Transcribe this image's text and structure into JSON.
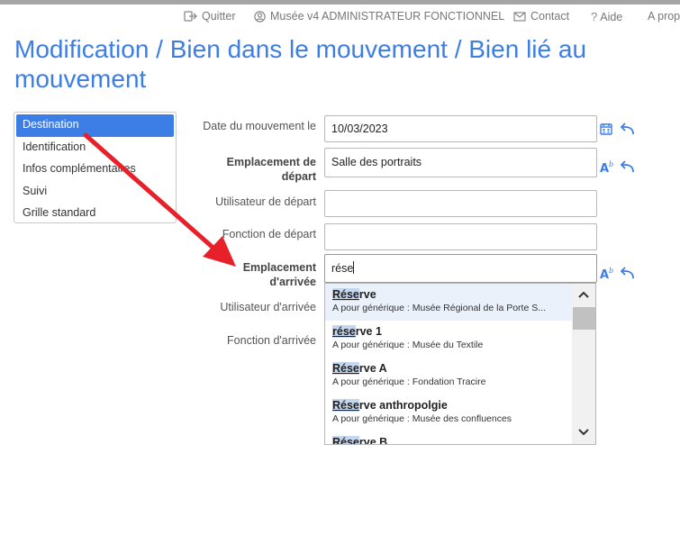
{
  "topnav": {
    "quit": "Quitter",
    "user": "Musée v4 ADMINISTRATEUR FONCTIONNEL",
    "contact": "Contact",
    "help": "Aide",
    "about": "A propos"
  },
  "page": {
    "title": "Modification / Bien dans le mouvement / Bien lié au mouvement"
  },
  "sidebar": {
    "items": [
      {
        "label": "Destination",
        "active": true
      },
      {
        "label": "Identification"
      },
      {
        "label": "Infos complémentaires"
      },
      {
        "label": "Suivi"
      },
      {
        "label": "Grille standard"
      }
    ]
  },
  "form": {
    "date": {
      "label": "Date du mouvement le",
      "value": "10/03/2023"
    },
    "departure_location": {
      "label_line1": "Emplacement de",
      "label_line2": "départ",
      "value": "Salle des portraits"
    },
    "departure_user": {
      "label": "Utilisateur de départ",
      "value": ""
    },
    "departure_function": {
      "label": "Fonction de départ",
      "value": ""
    },
    "arrival_location": {
      "label_line1": "Emplacement",
      "label_line2": "d'arrivée",
      "value": "rése"
    },
    "arrival_user": {
      "label": "Utilisateur d'arrivée"
    },
    "arrival_function": {
      "label": "Fonction d'arrivée"
    }
  },
  "autocomplete": {
    "options": [
      {
        "match": "Rése",
        "rest": "rve",
        "sub": "A pour générique : Musée Régional de la Porte S..."
      },
      {
        "match": "rése",
        "rest": "rve 1",
        "sub": "A pour générique : Musée du Textile"
      },
      {
        "match": "Rése",
        "rest": "rve A",
        "sub": "A pour générique : Fondation Tracire"
      },
      {
        "match": "Rése",
        "rest": "rve anthropolgie",
        "sub": "A pour générique : Musée des confluences"
      },
      {
        "match": "Rése",
        "rest": "rve B",
        "sub": ""
      }
    ]
  },
  "colors": {
    "accent": "#3d7ee6",
    "arrow": "#e8202a"
  }
}
